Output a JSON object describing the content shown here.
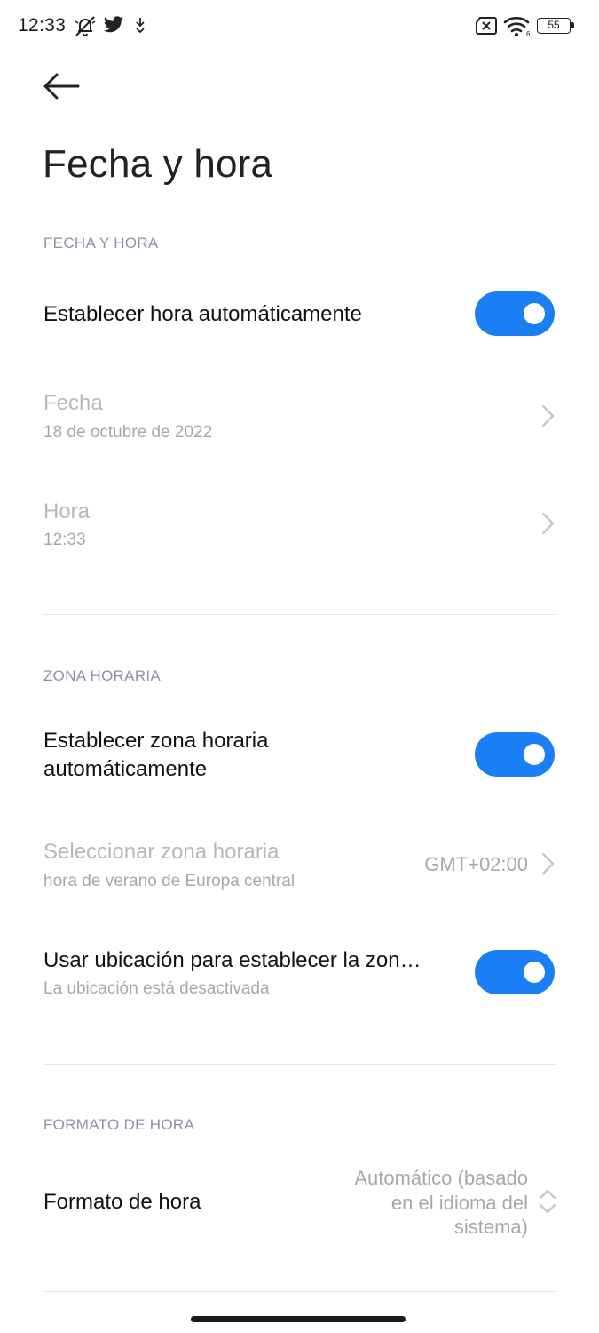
{
  "status_bar": {
    "time": "12:33",
    "battery_level": "55",
    "icons": [
      "notifications-muted-icon",
      "twitter-icon",
      "download-icon",
      "no-sim-icon",
      "wifi-icon",
      "battery-icon"
    ]
  },
  "header": {
    "back_icon": "back-arrow-icon",
    "title": "Fecha y hora"
  },
  "sections": {
    "date_time": {
      "label": "FECHA Y HORA",
      "auto_time": {
        "title": "Establecer hora automáticamente",
        "enabled": true
      },
      "date": {
        "title": "Fecha",
        "value": "18 de octubre de 2022"
      },
      "time": {
        "title": "Hora",
        "value": "12:33"
      }
    },
    "timezone": {
      "label": "ZONA HORARIA",
      "auto_zone": {
        "title_line1": "Establecer zona horaria",
        "title_line2": "automáticamente",
        "enabled": true
      },
      "select_zone": {
        "title": "Seleccionar zona horaria",
        "subtitle": "hora de verano de Europa central",
        "value": "GMT+02:00"
      },
      "use_location": {
        "title": "Usar ubicación para establecer la zon…",
        "subtitle": "La ubicación está desactivada",
        "enabled": true
      }
    },
    "time_format": {
      "label": "FORMATO DE HORA",
      "format": {
        "title": "Formato de hora",
        "value_line1": "Automático (basado",
        "value_line2": "en el idioma del",
        "value_line3": "sistema)"
      }
    }
  },
  "colors": {
    "accent": "#1a7ff5",
    "section_label": "#8a94a6",
    "disabled_text": "#b8b8b8"
  }
}
